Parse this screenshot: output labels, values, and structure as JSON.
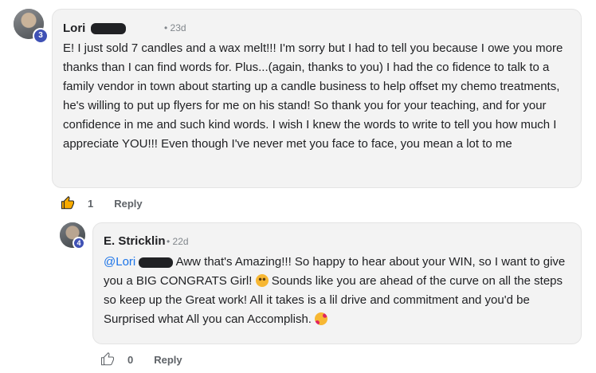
{
  "comments": [
    {
      "author": "Lori",
      "time": "23d",
      "level": "3",
      "body": "E! I just sold 7 candles and a wax melt!!! I'm sorry but I had to tell you because I owe you more thanks than I can find words for. Plus...(again, thanks to you) I had the co fidence to talk to a family vendor in town about starting up a candle business to help offset my chemo treatments, he's willing to put up flyers for me on his stand! So thank you for your teaching, and for your confidence in me and such kind words. I wish I knew the words to write to tell you how much I appreciate YOU!!! Even though I've never met you face to face, you mean a lot to me",
      "likes": "1",
      "liked": true,
      "reply_label": "Reply"
    },
    {
      "author": "E. Stricklin",
      "time": "22d",
      "level": "4",
      "mention": "@Lori",
      "body_part1": " Aww that's Amazing!!! So happy to hear about your WIN, so I want to give you a BIG CONGRATS Girl! ",
      "emoji1": "hugging-face-emoji",
      "body_part2": " Sounds like you are ahead of the curve on all the steps so keep up the Great work! All it takes is a lil drive and commitment and you'd be Surprised what All you can Accomplish. ",
      "emoji2": "face-with-hearts-emoji",
      "likes": "0",
      "liked": false,
      "reply_label": "Reply"
    }
  ],
  "colors": {
    "level_badge": "#3f51b5",
    "mention": "#1a73e8",
    "liked": "#f9ab00"
  }
}
